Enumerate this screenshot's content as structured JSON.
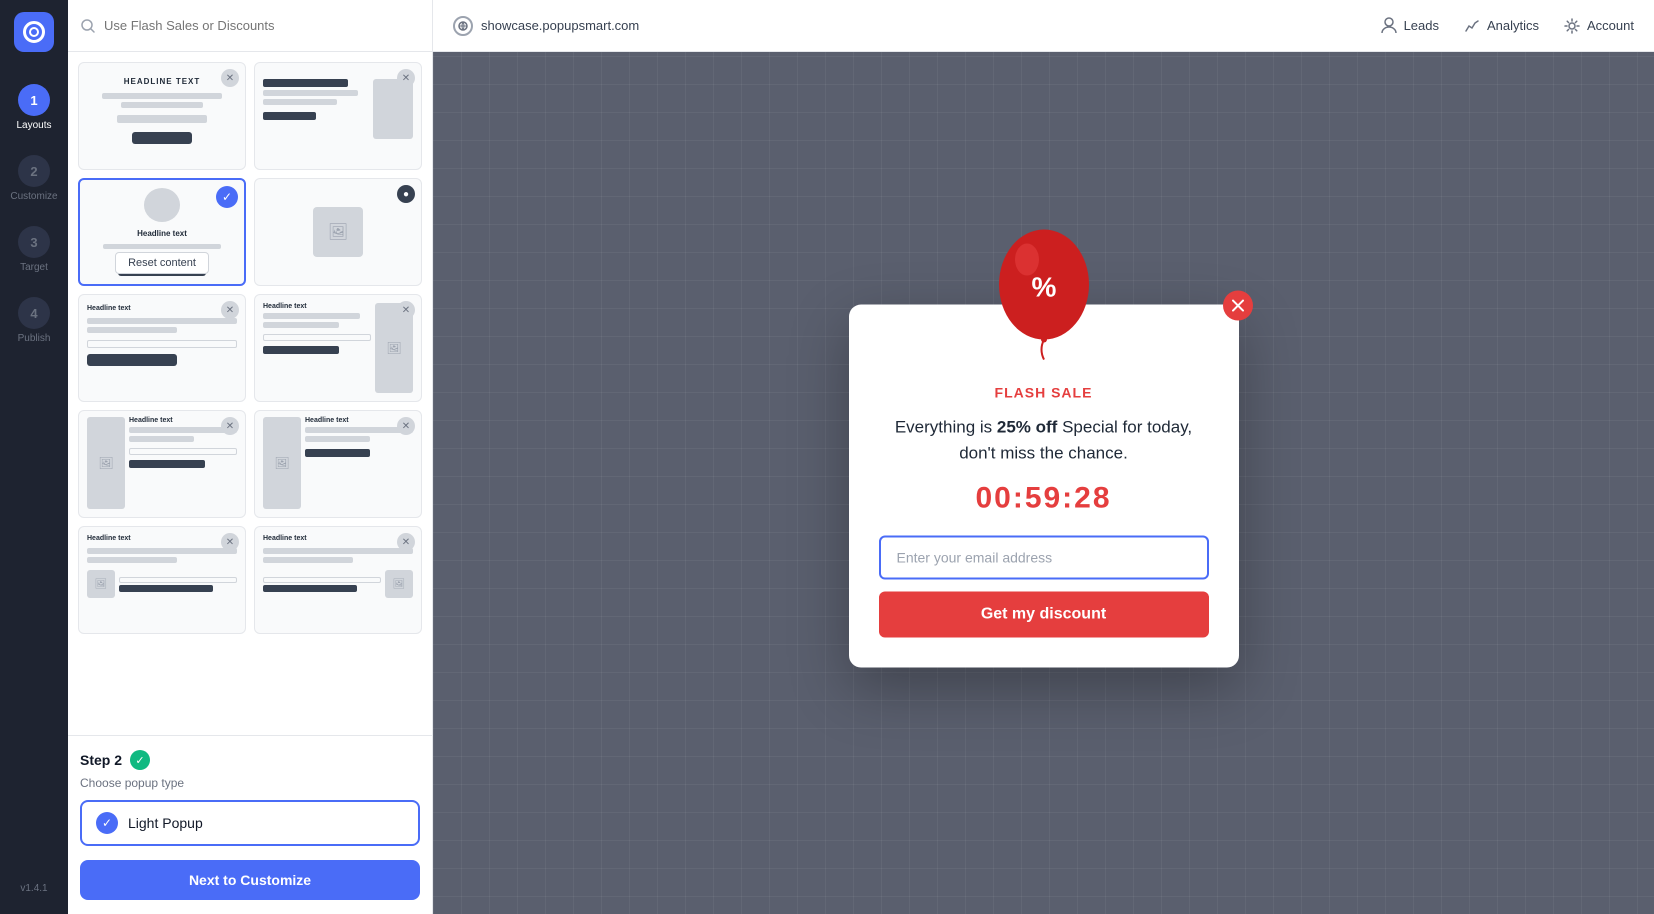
{
  "app": {
    "logo_aria": "Popupsmart logo",
    "version": "v1.4.1"
  },
  "topbar": {
    "search_placeholder": "Use Flash Sales or Discounts",
    "domain": "showcase.popupsmart.com",
    "nav_items": [
      {
        "id": "leads",
        "label": "Leads",
        "icon": "leads-icon"
      },
      {
        "id": "analytics",
        "label": "Analytics",
        "icon": "analytics-icon"
      },
      {
        "id": "account",
        "label": "Account",
        "icon": "account-icon"
      }
    ]
  },
  "sidebar": {
    "steps": [
      {
        "number": "1",
        "label": "Layouts",
        "active": true
      },
      {
        "number": "2",
        "label": "Customize",
        "active": false
      },
      {
        "number": "3",
        "label": "Target",
        "active": false
      },
      {
        "number": "4",
        "label": "Publish",
        "active": false
      }
    ]
  },
  "layouts": {
    "selected_index": 2,
    "cards": [
      {
        "id": 0,
        "type": "headline-center"
      },
      {
        "id": 1,
        "type": "headline-right"
      },
      {
        "id": 2,
        "type": "avatar-center",
        "selected": true,
        "reset_label": "Reset content"
      },
      {
        "id": 3,
        "type": "image-left"
      },
      {
        "id": 4,
        "type": "text-form"
      },
      {
        "id": 5,
        "type": "image-form-2col"
      },
      {
        "id": 6,
        "type": "image-form-small"
      },
      {
        "id": 7,
        "type": "image-right-form"
      },
      {
        "id": 8,
        "type": "text-image-left"
      },
      {
        "id": 9,
        "type": "text-image-right"
      }
    ]
  },
  "step2": {
    "label": "Step 2",
    "subtitle": "Choose popup type",
    "popup_type": "Light Popup",
    "next_button_label": "Next to Customize"
  },
  "popup": {
    "close_aria": "close popup",
    "badge_label": "FLASH SALE",
    "description_plain": "Everything is ",
    "description_bold": "25% off",
    "description_end": " Special for today, don't miss the chance.",
    "countdown": "00:59:28",
    "email_placeholder": "Enter your email address",
    "cta_label": "Get my discount",
    "colors": {
      "accent": "#e53e3e",
      "cta_bg": "#e53e3e",
      "border": "#4a6cf7"
    }
  }
}
